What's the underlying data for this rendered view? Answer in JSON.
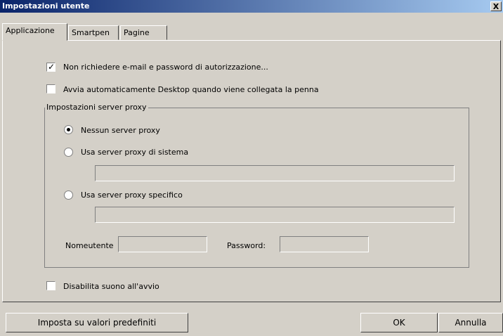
{
  "window": {
    "title": "Impostazioni utente",
    "close_label": "X"
  },
  "tabs": [
    {
      "label": "Applicazione"
    },
    {
      "label": "Smartpen"
    },
    {
      "label": "Pagine"
    }
  ],
  "options": {
    "no_auth": {
      "label": "Non richiedere e-mail e password di autorizzazione...",
      "checked": true
    },
    "autostart": {
      "label": "Avvia automaticamente Desktop quando viene collegata la penna",
      "checked": false
    },
    "disable_sound": {
      "label": "Disabilita suono all'avvio",
      "checked": false
    }
  },
  "proxy": {
    "title": "Impostazioni server proxy",
    "none": {
      "label": "Nessun server proxy",
      "selected": true
    },
    "system": {
      "label": "Usa server proxy di sistema",
      "value": ""
    },
    "specific": {
      "label": "Usa server proxy specifico",
      "value": ""
    },
    "username_label": "Nomeutente",
    "password_label": "Password:",
    "username_value": "",
    "password_value": ""
  },
  "buttons": {
    "defaults": "Imposta su valori predefiniti",
    "ok": "OK",
    "cancel": "Annulla"
  }
}
